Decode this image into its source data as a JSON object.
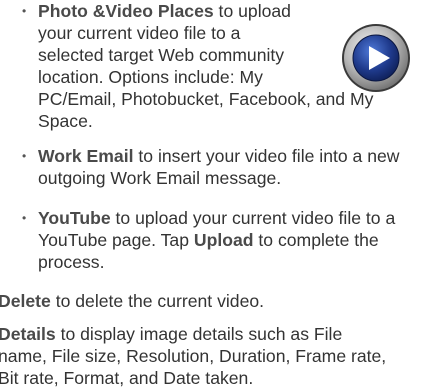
{
  "items": [
    {
      "term": "Photo &Video Places",
      "rest": " to upload your current video file to a selected target Web community location. Options include: My PC/Email, Photobucket, Facebook, and My Space."
    },
    {
      "term": "Work Email",
      "rest": " to insert your video file into a new outgoing Work Email message."
    },
    {
      "term": "YouTube",
      "rest1": " to upload your current video file to a YouTube page. Tap ",
      "term2": "Upload",
      "rest2": " to complete the process."
    }
  ],
  "delete": {
    "term": "Delete",
    "rest": " to delete the current video."
  },
  "details": {
    "term": "Details",
    "rest": " to display image details such as File name, File size, Resolution, Duration, Frame rate, Bit rate, Format, and Date taken."
  },
  "icon": {
    "name": "play-button-icon",
    "color": "#1f3a8c"
  }
}
